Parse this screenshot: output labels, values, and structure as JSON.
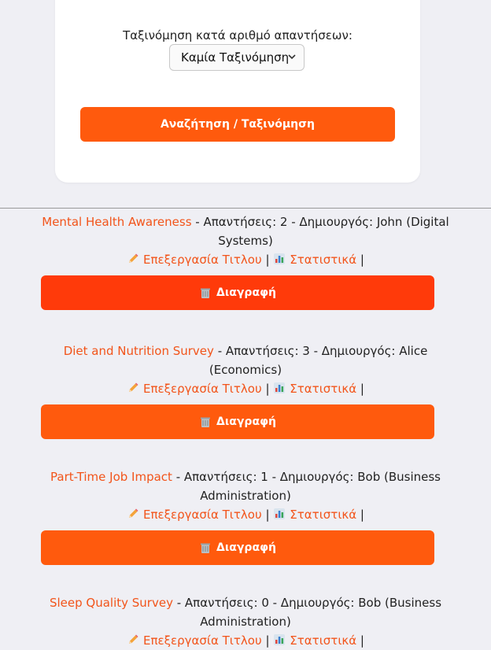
{
  "filter": {
    "sort_label": "Ταξινόμηση κατά αριθμό απαντήσεων:",
    "sort_selected": "Καμία Ταξινόμηση",
    "search_button": "Αναζήτηση / Ταξινόμηση"
  },
  "actions": {
    "edit_title": "Επεξεργασία Τιτλου",
    "stats": "Στατιστικά",
    "separator": "|",
    "delete": "Διαγραφή"
  },
  "surveys": [
    {
      "title": "Mental Health Awareness",
      "meta_line1": " - Απαντήσεις: 2 - Δημιουργός: John (Digital",
      "meta_line2": "Systems)"
    },
    {
      "title": "Diet and Nutrition Survey",
      "meta_line1": " - Απαντήσεις: 3 - Δημιουργός: Alice",
      "meta_line2": "(Economics)"
    },
    {
      "title": "Part-Time Job Impact",
      "meta_line1": " - Απαντήσεις: 1 - Δημιουργός: Bob (Business",
      "meta_line2": "Administration)"
    },
    {
      "title": "Sleep Quality Survey",
      "meta_line1": " - Απαντήσεις: 0 - Δημιουργός: Bob (Business",
      "meta_line2": "Administration)"
    }
  ],
  "colors": {
    "accent": "#ff5a0d",
    "accent_active": "#ff3a0a",
    "link": "#f2541a",
    "background": "#efeff4"
  }
}
